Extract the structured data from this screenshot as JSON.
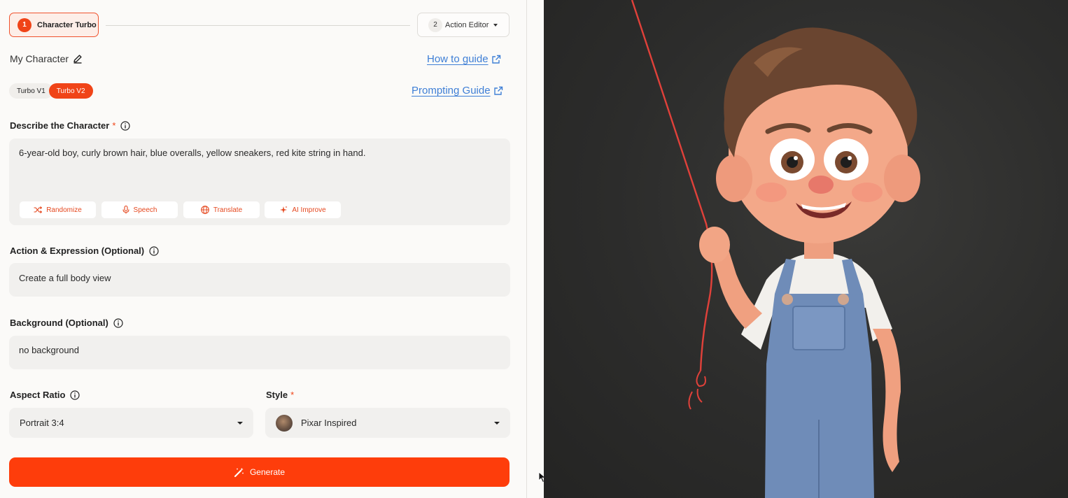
{
  "stepper": {
    "step1": {
      "num": "1",
      "label": "Character Turbo"
    },
    "step2": {
      "num": "2",
      "label": "Action Editor"
    }
  },
  "character": {
    "name": "My Character"
  },
  "links": {
    "how_to_guide": "How to guide",
    "prompting_guide": "Prompting Guide"
  },
  "model_toggle": {
    "v1": "Turbo V1",
    "v2": "Turbo V2",
    "selected": "Turbo V2"
  },
  "describe": {
    "label": "Describe the Character",
    "required_mark": "*",
    "value": "6-year-old boy, curly brown hair, blue overalls, yellow sneakers, red kite string in hand."
  },
  "tools": {
    "randomize": "Randomize",
    "speech": "Speech",
    "translate": "Translate",
    "ai_improve": "AI Improve"
  },
  "action": {
    "label": "Action & Expression (Optional)",
    "value": "Create a full body view"
  },
  "background": {
    "label": "Background (Optional)",
    "value": "no background"
  },
  "aspect_ratio": {
    "label": "Aspect Ratio",
    "value": "Portrait 3:4"
  },
  "style": {
    "label": "Style",
    "required_mark": "*",
    "value": "Pixar Inspired"
  },
  "generate": {
    "label": "Generate"
  },
  "colors": {
    "accent": "#fe3d0b",
    "link": "#3f7fd6",
    "field_bg": "#f1f0ee",
    "preview_bg": "#2c2c2b"
  },
  "preview": {
    "icon": "generated-character-image"
  }
}
